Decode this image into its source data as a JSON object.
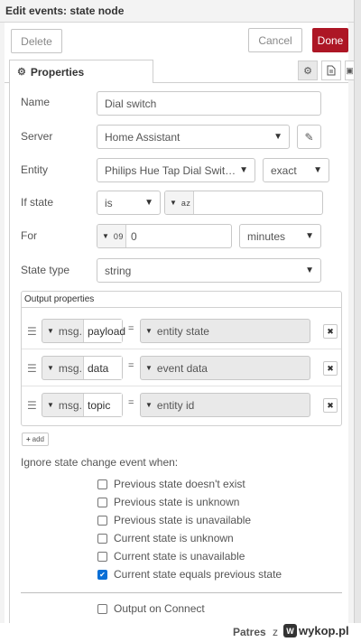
{
  "header": {
    "title": "Edit events: state node"
  },
  "buttons": {
    "delete": "Delete",
    "cancel": "Cancel",
    "done": "Done"
  },
  "tabs": {
    "properties": "Properties"
  },
  "form": {
    "name_label": "Name",
    "name_value": "Dial switch",
    "server_label": "Server",
    "server_value": "Home Assistant",
    "entity_label": "Entity",
    "entity_value": "Philips Hue Tap Dial Switch ...",
    "entity_match": "exact",
    "if_state_label": "If state",
    "if_state_op": "is",
    "if_state_type": "a z",
    "if_state_value": "",
    "for_label": "For",
    "for_type": "0 9",
    "for_value": "0",
    "for_unit": "minutes",
    "state_type_label": "State type",
    "state_type_value": "string"
  },
  "output_properties": {
    "title": "Output properties",
    "rows": [
      {
        "prefix": "msg.",
        "property": "payload",
        "eq": "=",
        "value": "entity state"
      },
      {
        "prefix": "msg.",
        "property": "data",
        "eq": "=",
        "value": "event data"
      },
      {
        "prefix": "msg.",
        "property": "topic",
        "eq": "=",
        "value": "entity id"
      }
    ],
    "add_label": "add"
  },
  "ignore": {
    "label": "Ignore state change event when:",
    "options": [
      {
        "label": "Previous state doesn't exist",
        "checked": false
      },
      {
        "label": "Previous state is unknown",
        "checked": false
      },
      {
        "label": "Previous state is unavailable",
        "checked": false
      },
      {
        "label": "Current state is unknown",
        "checked": false
      },
      {
        "label": "Current state is unavailable",
        "checked": false
      },
      {
        "label": "Current state equals previous state",
        "checked": true
      }
    ]
  },
  "output_on_connect": "Output on Connect",
  "footer": {
    "user": "Patres",
    "z": "z",
    "site": "wykop.pl"
  }
}
